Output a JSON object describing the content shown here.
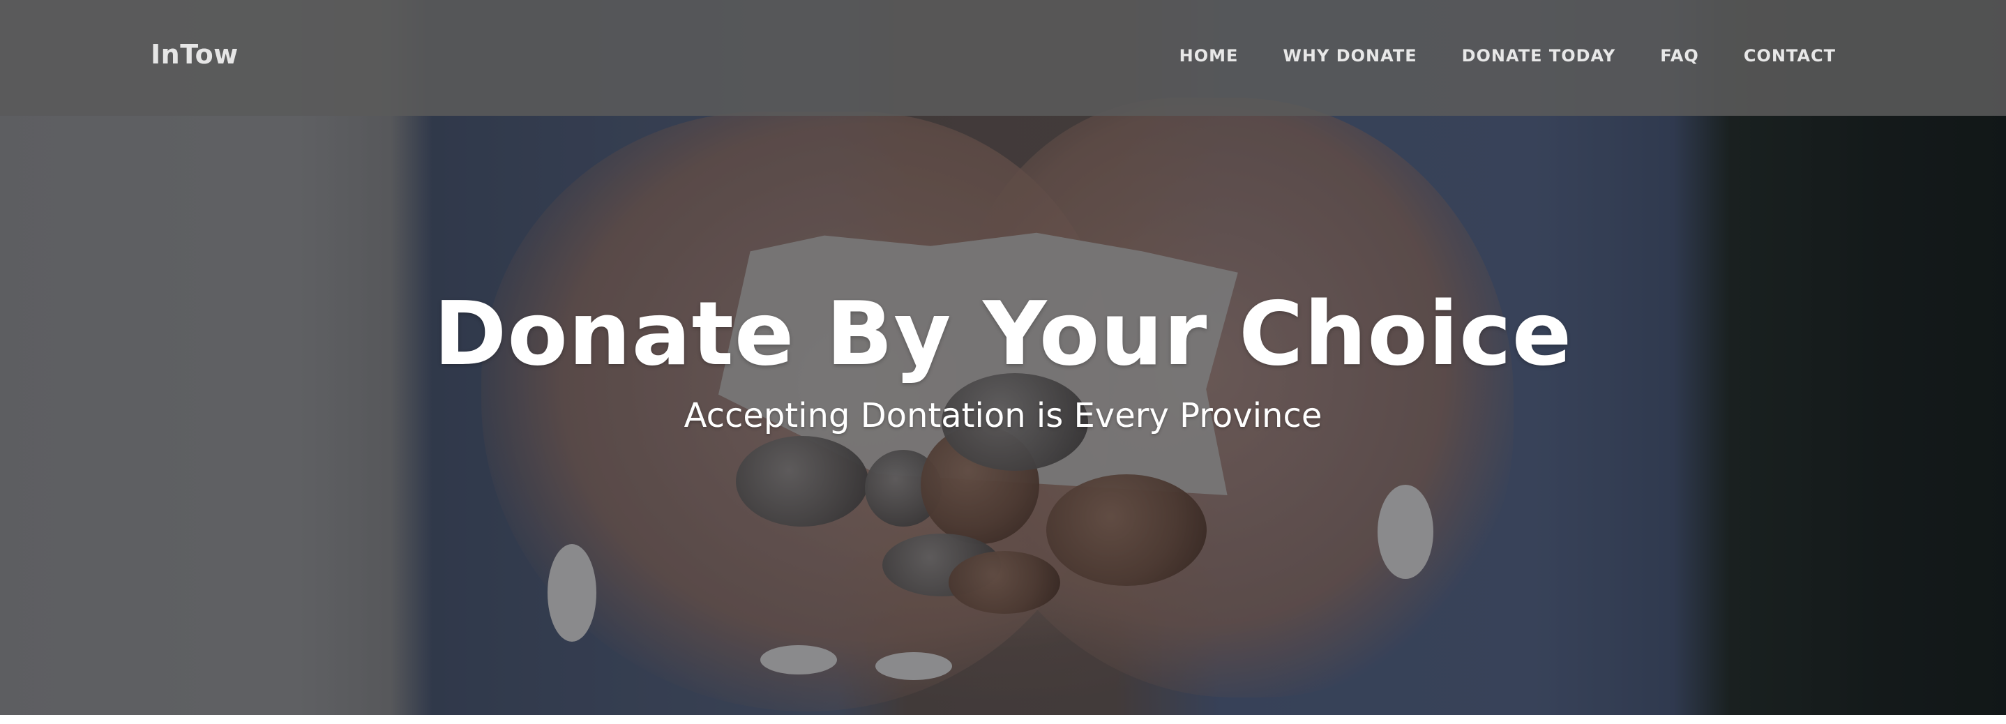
{
  "navbar": {
    "brand": "InTow",
    "links": [
      {
        "label": "HOME"
      },
      {
        "label": "WHY DONATE"
      },
      {
        "label": "DONATE TODAY"
      },
      {
        "label": "FAQ"
      },
      {
        "label": "CONTACT"
      }
    ]
  },
  "hero": {
    "title": "Donate By Your Choice",
    "subtitle": "Accepting Dontation is Every Province"
  },
  "colors": {
    "navbar_bg": "#5a5a5a",
    "text": "#ffffff",
    "nav_text": "#e8e8e8"
  }
}
